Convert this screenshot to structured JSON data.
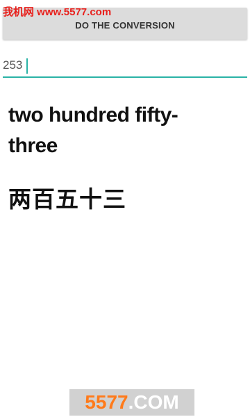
{
  "watermark_top": "我机网 www.5577.com",
  "toolbar": {
    "convert_label": "DO THE CONVERSION"
  },
  "input": {
    "value": "253"
  },
  "results": {
    "english": "two hundred fifty-three",
    "chinese": "两百五十三"
  },
  "watermark_bottom": {
    "number": "5577",
    "suffix": ".COM"
  },
  "colors": {
    "accent": "#2ab3a6",
    "button_bg": "#dcdcdc",
    "watermark_red": "#e8201c",
    "watermark_orange": "#ff7a1a"
  }
}
